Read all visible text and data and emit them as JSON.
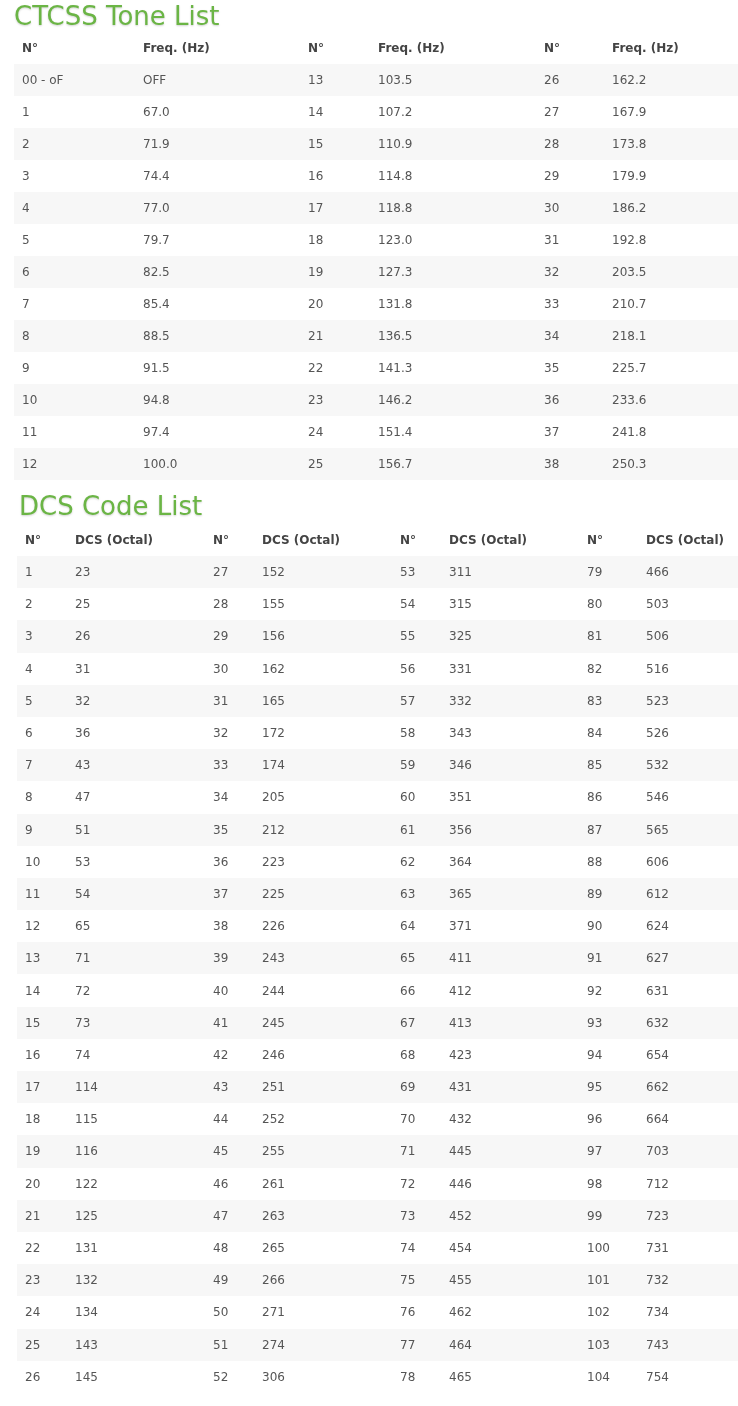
{
  "sections": [
    {
      "title": "CTCSS Tone List",
      "columns": [
        "N°",
        "Freq. (Hz)",
        "N°",
        "Freq. (Hz)",
        "N°",
        "Freq. (Hz)"
      ],
      "rows": [
        [
          "00 - oF",
          "OFF",
          "13",
          "103.5",
          "26",
          "162.2"
        ],
        [
          "1",
          "67.0",
          "14",
          "107.2",
          "27",
          "167.9"
        ],
        [
          "2",
          "71.9",
          "15",
          "110.9",
          "28",
          "173.8"
        ],
        [
          "3",
          "74.4",
          "16",
          "114.8",
          "29",
          "179.9"
        ],
        [
          "4",
          "77.0",
          "17",
          "118.8",
          "30",
          "186.2"
        ],
        [
          "5",
          "79.7",
          "18",
          "123.0",
          "31",
          "192.8"
        ],
        [
          "6",
          "82.5",
          "19",
          "127.3",
          "32",
          "203.5"
        ],
        [
          "7",
          "85.4",
          "20",
          "131.8",
          "33",
          "210.7"
        ],
        [
          "8",
          "88.5",
          "21",
          "136.5",
          "34",
          "218.1"
        ],
        [
          "9",
          "91.5",
          "22",
          "141.3",
          "35",
          "225.7"
        ],
        [
          "10",
          "94.8",
          "23",
          "146.2",
          "36",
          "233.6"
        ],
        [
          "11",
          "97.4",
          "24",
          "151.4",
          "37",
          "241.8"
        ],
        [
          "12",
          "100.0",
          "25",
          "156.7",
          "38",
          "250.3"
        ]
      ]
    },
    {
      "title": "DCS Code List",
      "columns": [
        "N°",
        "DCS (Octal)",
        "N°",
        "DCS (Octal)",
        "N°",
        "DCS (Octal)",
        "N°",
        "DCS (Octal)"
      ],
      "rows": [
        [
          "1",
          "23",
          "27",
          "152",
          "53",
          "311",
          "79",
          "466"
        ],
        [
          "2",
          "25",
          "28",
          "155",
          "54",
          "315",
          "80",
          "503"
        ],
        [
          "3",
          "26",
          "29",
          "156",
          "55",
          "325",
          "81",
          "506"
        ],
        [
          "4",
          "31",
          "30",
          "162",
          "56",
          "331",
          "82",
          "516"
        ],
        [
          "5",
          "32",
          "31",
          "165",
          "57",
          "332",
          "83",
          "523"
        ],
        [
          "6",
          "36",
          "32",
          "172",
          "58",
          "343",
          "84",
          "526"
        ],
        [
          "7",
          "43",
          "33",
          "174",
          "59",
          "346",
          "85",
          "532"
        ],
        [
          "8",
          "47",
          "34",
          "205",
          "60",
          "351",
          "86",
          "546"
        ],
        [
          "9",
          "51",
          "35",
          "212",
          "61",
          "356",
          "87",
          "565"
        ],
        [
          "10",
          "53",
          "36",
          "223",
          "62",
          "364",
          "88",
          "606"
        ],
        [
          "11",
          "54",
          "37",
          "225",
          "63",
          "365",
          "89",
          "612"
        ],
        [
          "12",
          "65",
          "38",
          "226",
          "64",
          "371",
          "90",
          "624"
        ],
        [
          "13",
          "71",
          "39",
          "243",
          "65",
          "411",
          "91",
          "627"
        ],
        [
          "14",
          "72",
          "40",
          "244",
          "66",
          "412",
          "92",
          "631"
        ],
        [
          "15",
          "73",
          "41",
          "245",
          "67",
          "413",
          "93",
          "632"
        ],
        [
          "16",
          "74",
          "42",
          "246",
          "68",
          "423",
          "94",
          "654"
        ],
        [
          "17",
          "114",
          "43",
          "251",
          "69",
          "431",
          "95",
          "662"
        ],
        [
          "18",
          "115",
          "44",
          "252",
          "70",
          "432",
          "96",
          "664"
        ],
        [
          "19",
          "116",
          "45",
          "255",
          "71",
          "445",
          "97",
          "703"
        ],
        [
          "20",
          "122",
          "46",
          "261",
          "72",
          "446",
          "98",
          "712"
        ],
        [
          "21",
          "125",
          "47",
          "263",
          "73",
          "452",
          "99",
          "723"
        ],
        [
          "22",
          "131",
          "48",
          "265",
          "74",
          "454",
          "100",
          "731"
        ],
        [
          "23",
          "132",
          "49",
          "266",
          "75",
          "455",
          "101",
          "732"
        ],
        [
          "24",
          "134",
          "50",
          "271",
          "76",
          "462",
          "102",
          "734"
        ],
        [
          "25",
          "143",
          "51",
          "274",
          "77",
          "464",
          "103",
          "743"
        ],
        [
          "26",
          "145",
          "52",
          "306",
          "78",
          "465",
          "104",
          "754"
        ]
      ]
    }
  ]
}
